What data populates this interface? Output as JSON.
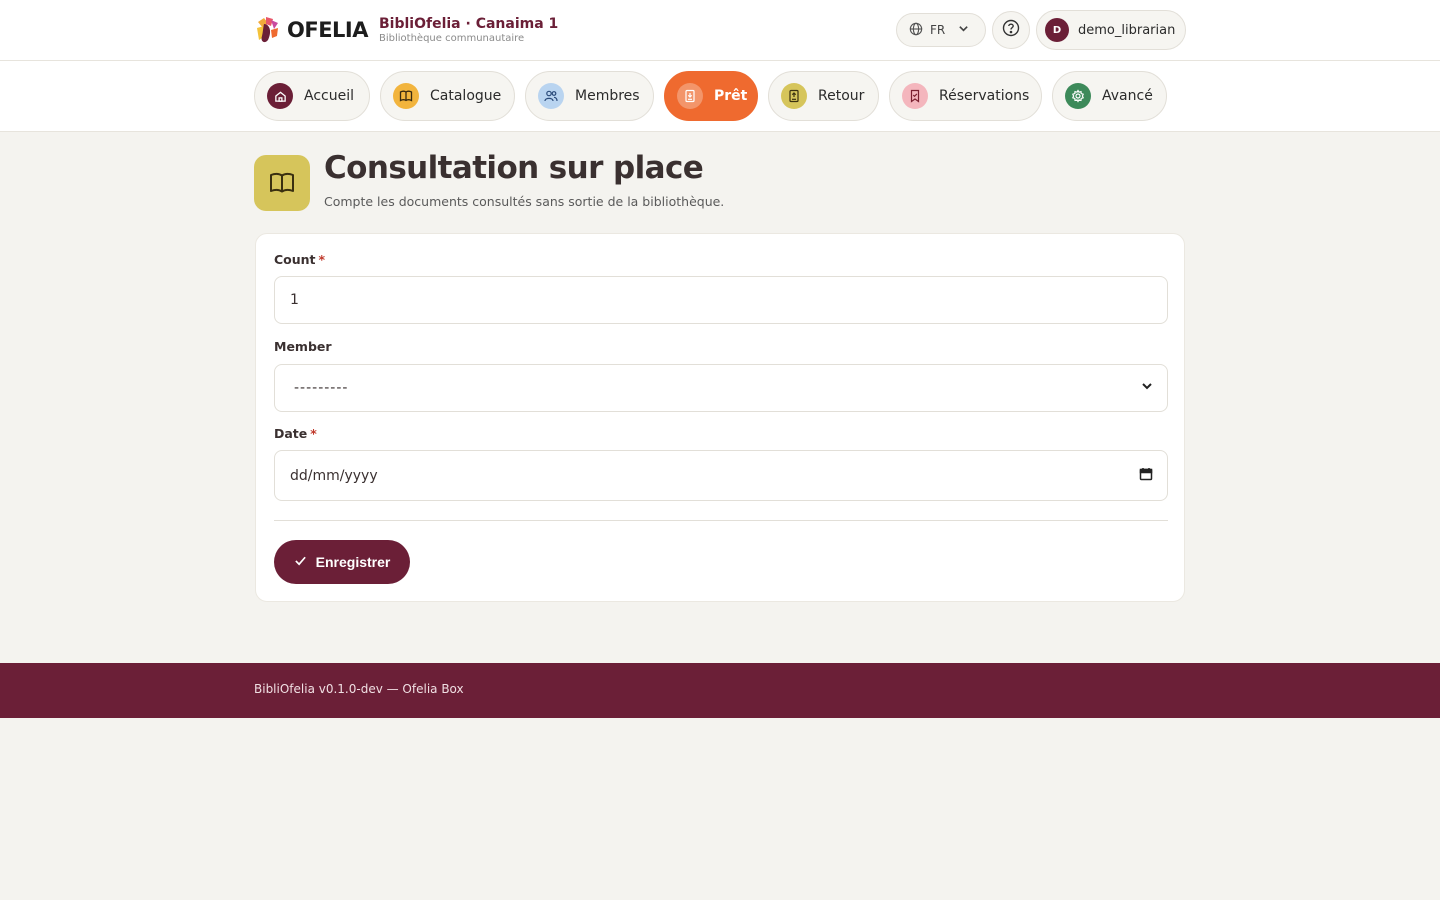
{
  "header": {
    "logo_word": "OFELIA",
    "title": "BibliOfelia · Canaima 1",
    "subtitle": "Bibliothèque communautaire",
    "language": "FR",
    "user_initial": "D",
    "username": "demo_librarian"
  },
  "nav": [
    {
      "label": "Accueil",
      "icon": "home-icon"
    },
    {
      "label": "Catalogue",
      "icon": "book-icon"
    },
    {
      "label": "Membres",
      "icon": "users-icon"
    },
    {
      "label": "Prêt",
      "icon": "loan-icon",
      "active": true
    },
    {
      "label": "Retour",
      "icon": "return-icon"
    },
    {
      "label": "Réservations",
      "icon": "bookmark-icon"
    },
    {
      "label": "Avancé",
      "icon": "gear-icon"
    }
  ],
  "page": {
    "title": "Consultation sur place",
    "subtitle": "Compte les documents consultés sans sortie de la bibliothèque."
  },
  "form": {
    "count_label": "Count",
    "count_value": "1",
    "member_label": "Member",
    "member_value": "---------",
    "date_label": "Date",
    "date_placeholder": "dd/mm/yyyy",
    "required_mark": "*",
    "save_label": "Enregistrer"
  },
  "footer": {
    "text": "BibliOfelia v0.1.0-dev — Ofelia Box"
  },
  "colors": {
    "brand": "#6b1f37",
    "accent": "#ef6a2f",
    "title_icon_bg": "#d6c55b"
  }
}
